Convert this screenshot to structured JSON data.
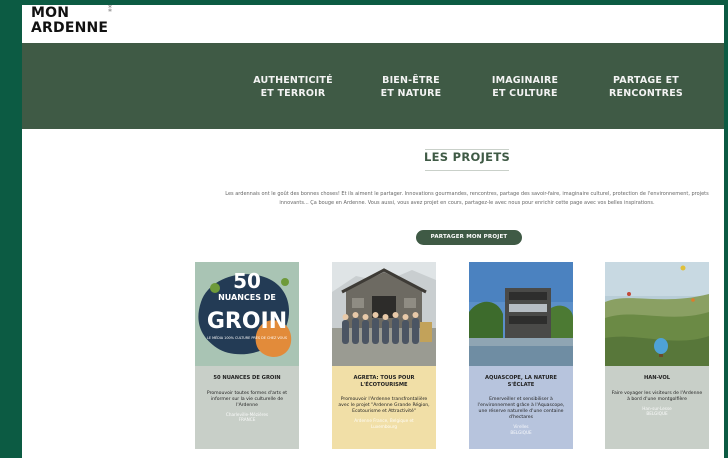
{
  "brand": {
    "line1": "MON",
    "line2": "ARDENNE",
    "mark": "⁑"
  },
  "nav": [
    {
      "line1": "AUTHENTICITÉ",
      "line2": "ET TERROIR"
    },
    {
      "line1": "BIEN-ÊTRE",
      "line2": "ET NATURE"
    },
    {
      "line1": "IMAGINAIRE",
      "line2": "ET CULTURE"
    },
    {
      "line1": "PARTAGE ET",
      "line2": "RENCONTRES"
    }
  ],
  "section": {
    "title": "LES PROJETS",
    "intro": "Les ardennais ont le goût des bonnes choses! Et ils aiment le partager. Innovations gourmandes, rencontres, partage des savoir-faire, imaginaire culturel, protection de l'environnement, projets innovants... Ça bouge en Ardenne. Vous aussi, vous avez projet en cours, partagez-le avec nous pour enrichir cette page avec vos belles inspirations.",
    "button": "PARTAGER MON PROJET"
  },
  "cards": [
    {
      "title": "50 NUANCES DE GROIN",
      "desc": "Promouvoir toutes formes d'arts et informer sur la vie culturelle de l'Ardenne",
      "meta1": "Charleville-Mézières",
      "meta2": "FRANCE",
      "poster": {
        "num": "50",
        "line": "NUANCES DE",
        "word": "GROIN",
        "tag": "LE MÉDIA 100% CULTURE PRÈS DE CHEZ VOUS"
      }
    },
    {
      "title": "AGRETA: TOUS POUR L'ÉCOTOURISME",
      "desc": "Promouvoir l'Ardenne transfrontalière avec le projet \"Ardenne Grande Région, Ecotourisme et Attractivité\"",
      "meta1": "Ardenne France, Belgique et",
      "meta2": "Luxembourg"
    },
    {
      "title": "AQUASCOPE, LA NATURE S'ÉCLATE",
      "desc": "Emerveiller et sensibiliser à l'environnement grâce à l'Aquascope, une réserve naturelle d'une centaine d'hectares",
      "meta1": "Virelles",
      "meta2": "BELGIQUE"
    },
    {
      "title": "HAN-VOL",
      "desc": "Faire voyager les visiteurs de l'Ardenne à bord d'une montgolfière",
      "meta1": "Han-sur-Lesse",
      "meta2": "BELGIQUE"
    }
  ],
  "colors": {
    "background": "#0c5b43",
    "nav": "#3f5a45",
    "poster": "#a9c4b4",
    "poster_dark": "#233b55",
    "poster_orange": "#e28b3a"
  }
}
